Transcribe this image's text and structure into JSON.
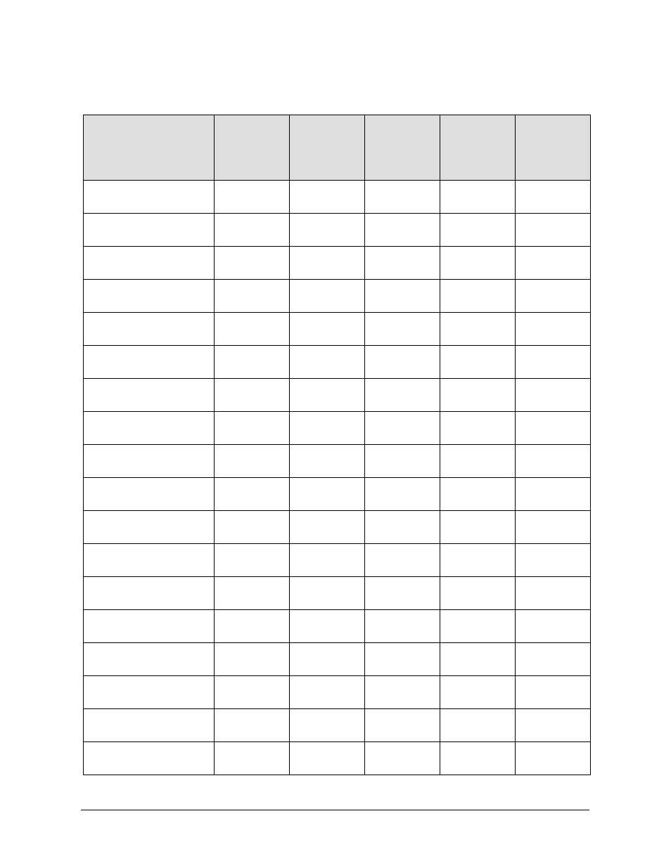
{
  "table": {
    "headers": [
      "",
      "",
      "",
      "",
      "",
      ""
    ],
    "rows": [
      [
        "",
        "",
        "",
        "",
        "",
        ""
      ],
      [
        "",
        "",
        "",
        "",
        "",
        ""
      ],
      [
        "",
        "",
        "",
        "",
        "",
        ""
      ],
      [
        "",
        "",
        "",
        "",
        "",
        ""
      ],
      [
        "",
        "",
        "",
        "",
        "",
        ""
      ],
      [
        "",
        "",
        "",
        "",
        "",
        ""
      ],
      [
        "",
        "",
        "",
        "",
        "",
        ""
      ],
      [
        "",
        "",
        "",
        "",
        "",
        ""
      ],
      [
        "",
        "",
        "",
        "",
        "",
        ""
      ],
      [
        "",
        "",
        "",
        "",
        "",
        ""
      ],
      [
        "",
        "",
        "",
        "",
        "",
        ""
      ],
      [
        "",
        "",
        "",
        "",
        "",
        ""
      ],
      [
        "",
        "",
        "",
        "",
        "",
        ""
      ],
      [
        "",
        "",
        "",
        "",
        "",
        ""
      ],
      [
        "",
        "",
        "",
        "",
        "",
        ""
      ],
      [
        "",
        "",
        "",
        "",
        "",
        ""
      ],
      [
        "",
        "",
        "",
        "",
        "",
        ""
      ],
      [
        "",
        "",
        "",
        "",
        "",
        ""
      ]
    ]
  }
}
